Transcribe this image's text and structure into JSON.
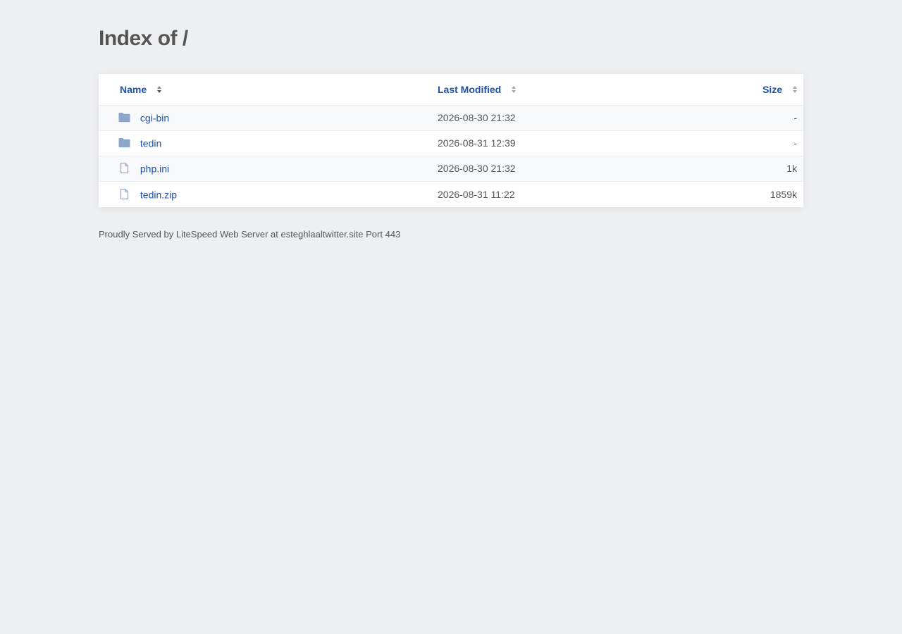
{
  "page": {
    "title": "Index of /"
  },
  "table": {
    "headers": {
      "name": "Name",
      "modified": "Last Modified",
      "size": "Size"
    },
    "rows": [
      {
        "type": "folder",
        "name": "cgi-bin",
        "modified": "2026-08-30 21:32",
        "size": "-"
      },
      {
        "type": "folder",
        "name": "tedin",
        "modified": "2026-08-31 12:39",
        "size": "-"
      },
      {
        "type": "file",
        "name": "php.ini",
        "modified": "2026-08-30 21:32",
        "size": "1k"
      },
      {
        "type": "file",
        "name": "tedin.zip",
        "modified": "2026-08-31 11:22",
        "size": "1859k"
      }
    ]
  },
  "footer": {
    "text": "Proudly Served by LiteSpeed Web Server at esteghlaaltwitter.site Port 443"
  },
  "colors": {
    "background": "#eeeff1",
    "link": "#1f52a8",
    "text": "#555555",
    "folder_icon": "#8ca6cc",
    "file_icon": "#8ca6cc"
  },
  "icons": {
    "folder": "folder-icon",
    "file": "file-icon",
    "sort": "sort-icon"
  }
}
